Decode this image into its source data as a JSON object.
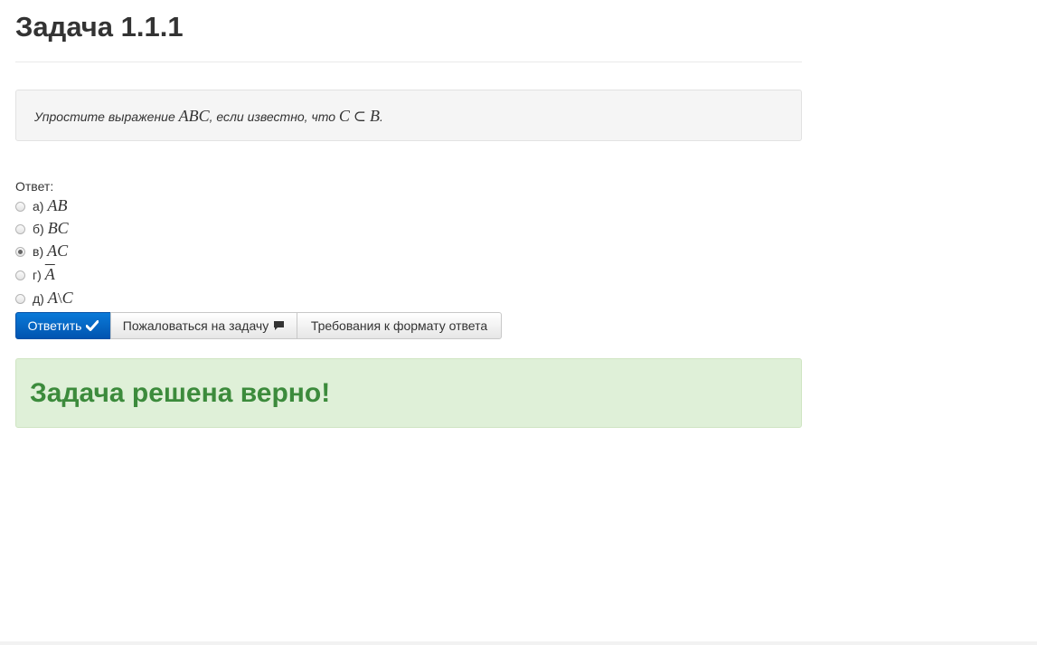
{
  "page": {
    "title": "Задача 1.1.1"
  },
  "problem": {
    "prefix": "Упростите выражение",
    "expr": "ABC",
    "middle": ", если известно, что",
    "condition_left": "C",
    "condition_op": "⊂",
    "condition_right": "B",
    "suffix": "."
  },
  "answer": {
    "label": "Ответ:",
    "options": [
      {
        "prefix": "а)",
        "math": "AB",
        "checked": false
      },
      {
        "prefix": "б)",
        "math": "BC",
        "checked": false
      },
      {
        "prefix": "в)",
        "math": "AC",
        "checked": true
      },
      {
        "prefix": "г)",
        "math": "A",
        "checked": false,
        "overline": true
      },
      {
        "prefix": "д)",
        "math_left": "A",
        "math_op": "\\",
        "math_right": "C",
        "checked": false
      }
    ]
  },
  "buttons": {
    "submit": "Ответить",
    "submit_icon": "check-icon",
    "complain": "Пожаловаться на задачу",
    "complain_icon": "comment-icon",
    "format": "Требования к формату ответа"
  },
  "result": {
    "message": "Задача решена верно!",
    "color": "#3c8b3c",
    "background": "#dff0d8"
  },
  "colors": {
    "primary": "#0154b0"
  }
}
